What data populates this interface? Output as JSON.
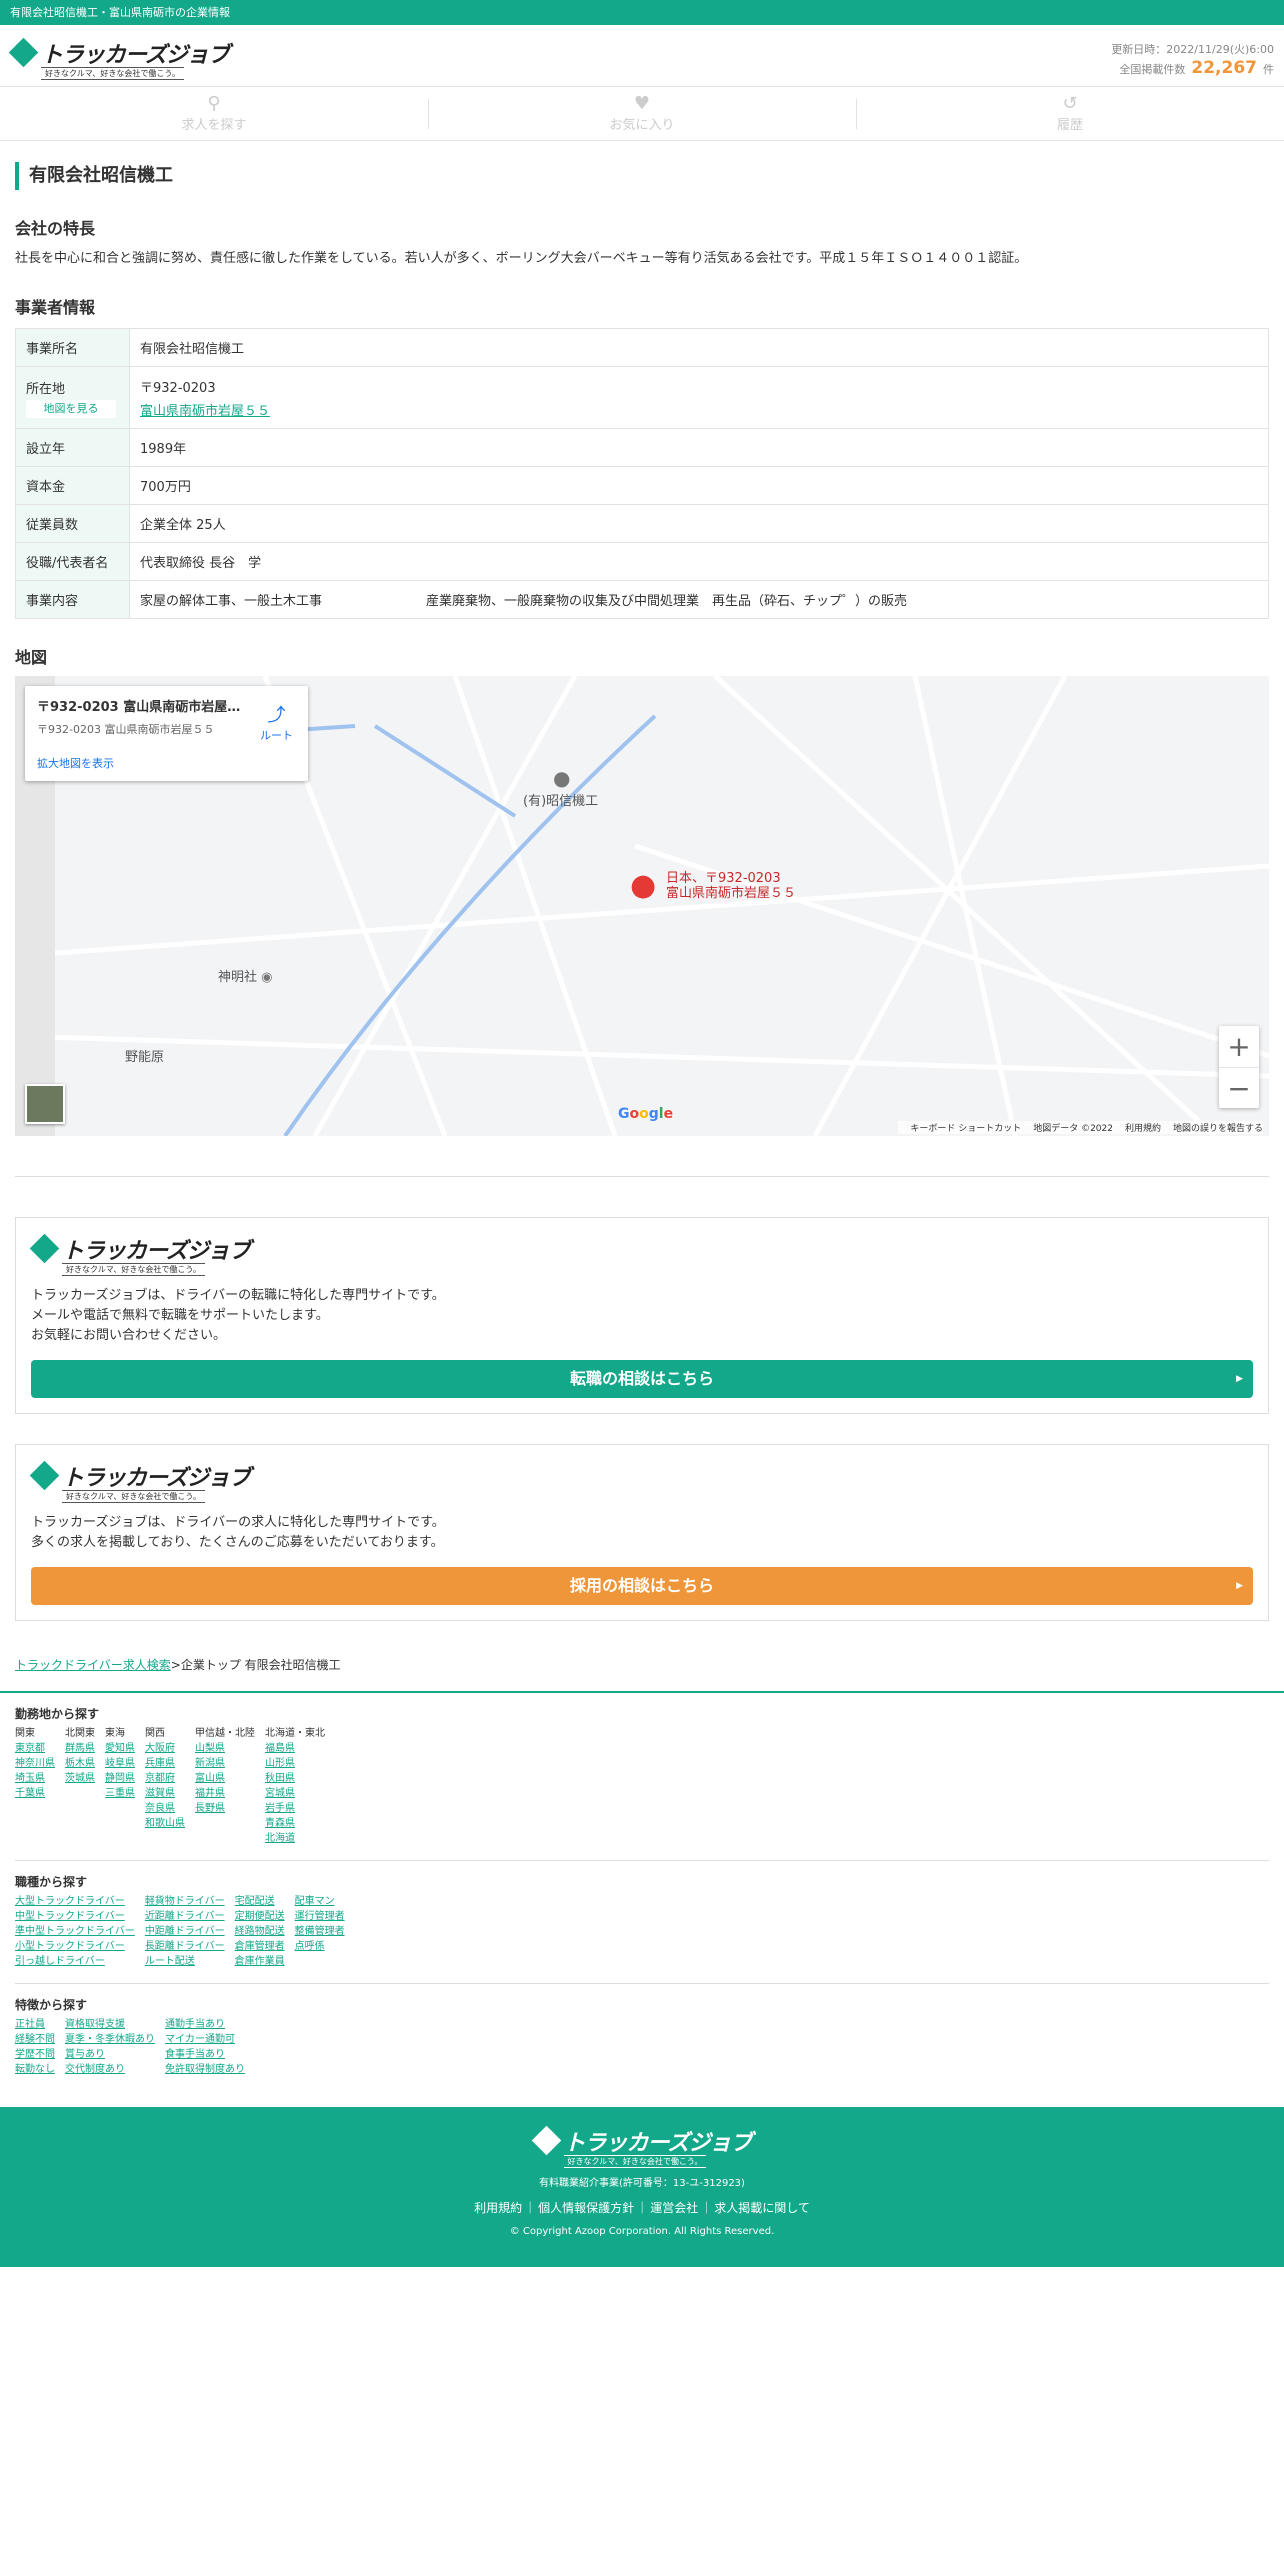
{
  "top_bar": "有限会社昭信機工・富山県南砺市の企業情報",
  "logo": {
    "name": "トラッカーズジョブ",
    "tagline": "好きなクルマ、好きな会社で働こう。"
  },
  "update": {
    "label": "更新日時：2022/11/29(火)6:00",
    "count_label": "全国掲載件数",
    "count": "22,267",
    "unit": "件"
  },
  "nav": [
    {
      "label": "求人を探す",
      "icon": "search-icon"
    },
    {
      "label": "お気に入り",
      "icon": "heart-icon"
    },
    {
      "label": "履歴",
      "icon": "history-icon"
    }
  ],
  "company_title": "有限会社昭信機工",
  "features": {
    "heading": "会社の特長",
    "text": "社長を中心に和合と強調に努め、責任感に徹した作業をしている。若い人が多く、ボーリング大会バーベキュー等有り活気ある会社です。平成１５年ＩＳＯ１４００１認証。"
  },
  "info": {
    "heading": "事業者情報",
    "rows": [
      {
        "k": "事業所名",
        "v": "有限会社昭信機工"
      },
      {
        "k": "所在地",
        "map_btn": "地図を見る",
        "zip": "〒932-0203",
        "addr": "富山県南砺市岩屋５５"
      },
      {
        "k": "設立年",
        "v": "1989年"
      },
      {
        "k": "資本金",
        "v": "700万円"
      },
      {
        "k": "従業員数",
        "v": "企業全体 25人"
      },
      {
        "k": "役職/代表者名",
        "v": "代表取締役 長谷　学"
      },
      {
        "k": "事業内容",
        "v": "家屋の解体工事、一般土木工事　　　　　　　　産業廃棄物、一般廃棄物の収集及び中間処理業　再生品（砕石、チップ゜）の販売"
      }
    ]
  },
  "map": {
    "heading": "地図",
    "card_title": "〒932-0203 富山県南砺市岩屋…",
    "card_addr": "〒932-0203 富山県南砺市岩屋５５",
    "route": "ルート",
    "large": "拡大地図を表示",
    "place": "(有)昭信機工",
    "pin1": "日本、〒932-0203",
    "pin2": "富山県南砺市岩屋５５",
    "shrine": "神明社",
    "area": "野能原",
    "google": "Google",
    "footer": [
      "キーボード ショートカット",
      "地図データ ©2022",
      "利用規約",
      "地図の誤りを報告する"
    ]
  },
  "promo1": {
    "text": [
      "トラッカーズジョブは、ドライバーの転職に特化した専門サイトです。",
      "メールや電話で無料で転職をサポートいたします。",
      "お気軽にお問い合わせください。"
    ],
    "button": "転職の相談はこちら",
    "color": "#13a88a"
  },
  "promo2": {
    "text": [
      "トラッカーズジョブは、ドライバーの求人に特化した専門サイトです。",
      "多くの求人を掲載しており、たくさんのご応募をいただいております。"
    ],
    "button": "採用の相談はこちら",
    "color": "#f0963a"
  },
  "breadcrumb": {
    "link": "トラックドライバー求人検索",
    "rest": ">企業トップ 有限会社昭信機工"
  },
  "area_search": {
    "heading": "勤務地から探す",
    "cols": [
      {
        "h": "関東",
        "items": [
          "東京都",
          "神奈川県",
          "埼玉県",
          "千葉県"
        ]
      },
      {
        "h": "北関東",
        "items": [
          "群馬県",
          "栃木県",
          "茨城県"
        ]
      },
      {
        "h": "東海",
        "items": [
          "愛知県",
          "岐阜県",
          "静岡県",
          "三重県"
        ]
      },
      {
        "h": "関西",
        "items": [
          "大阪府",
          "兵庫県",
          "京都府",
          "滋賀県",
          "奈良県",
          "和歌山県"
        ]
      },
      {
        "h": "甲信越・北陸",
        "items": [
          "山梨県",
          "新潟県",
          "富山県",
          "福井県",
          "長野県"
        ]
      },
      {
        "h": "北海道・東北",
        "items": [
          "福島県",
          "山形県",
          "秋田県",
          "宮城県",
          "岩手県",
          "青森県",
          "北海道"
        ]
      }
    ]
  },
  "job_search": {
    "heading": "職種から探す",
    "cols": [
      {
        "items": [
          "大型トラックドライバー",
          "中型トラックドライバー",
          "準中型トラックドライバー",
          "小型トラックドライバー",
          "引っ越しドライバー"
        ]
      },
      {
        "items": [
          "軽貨物ドライバー",
          "近距離ドライバー",
          "中距離ドライバー",
          "長距離ドライバー",
          "ルート配送"
        ]
      },
      {
        "items": [
          "宅配配送",
          "定期便配送",
          "経路物配送",
          "倉庫管理者",
          "倉庫作業員"
        ]
      },
      {
        "items": [
          "配車マン",
          "運行管理者",
          "整備管理者",
          "点呼係"
        ]
      }
    ]
  },
  "feature_search": {
    "heading": "特徴から探す",
    "cols": [
      {
        "items": [
          "正社員",
          "経験不問",
          "学歴不問",
          "転勤なし"
        ]
      },
      {
        "items": [
          "資格取得支援",
          "夏季・冬季休暇あり",
          "賞与あり",
          "交代制度あり"
        ]
      },
      {
        "items": [
          "通勤手当あり",
          "マイカー通勤可",
          "食事手当あり",
          "免許取得制度あり"
        ]
      }
    ]
  },
  "footer": {
    "license": "有料職業紹介事業(許可番号：13-ユ-312923)",
    "links": [
      "利用規約",
      "個人情報保護方針",
      "運営会社",
      "求人掲載に関して"
    ],
    "copyright": "© Copyright Azoop Corporation. All Rights Reserved."
  }
}
